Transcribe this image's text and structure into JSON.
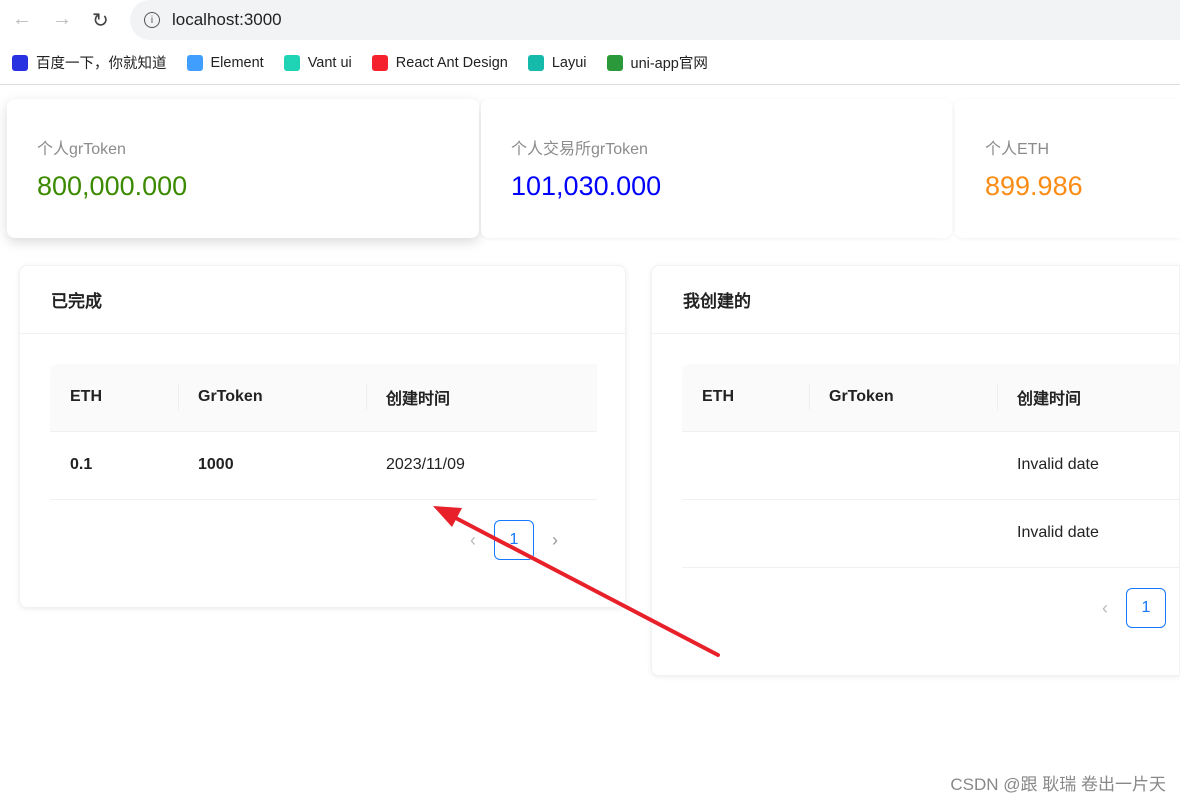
{
  "browser": {
    "url": "localhost:3000",
    "bookmarks": [
      {
        "label": "百度一下，你就知道",
        "color": "#2932e1"
      },
      {
        "label": "Element",
        "color": "#409eff"
      },
      {
        "label": "Vant ui",
        "color": "#1fd3b5"
      },
      {
        "label": "React Ant Design",
        "color": "#f5222d"
      },
      {
        "label": "Layui",
        "color": "#16baaa"
      },
      {
        "label": "uni-app官网",
        "color": "#2b9939"
      }
    ]
  },
  "stats": [
    {
      "title": "个人grToken",
      "value": "800,000.000",
      "color": "#3c8a00"
    },
    {
      "title": "个人交易所grToken",
      "value": "101,030.000",
      "color": "#0000ff"
    },
    {
      "title": "个人ETH",
      "value": "899.986",
      "color": "#fa8c16"
    }
  ],
  "completed": {
    "title": "已完成",
    "columns": [
      "ETH",
      "GrToken",
      "创建时间"
    ],
    "rows": [
      [
        "0.1",
        "1000",
        "2023/11/09"
      ]
    ],
    "page": "1"
  },
  "created": {
    "title": "我创建的",
    "columns": [
      "ETH",
      "GrToken",
      "创建时间"
    ],
    "rows": [
      [
        "",
        "",
        "Invalid date"
      ],
      [
        "",
        "",
        "Invalid date"
      ]
    ],
    "page": "1"
  },
  "watermark": "CSDN @跟 耿瑞 卷出一片天"
}
